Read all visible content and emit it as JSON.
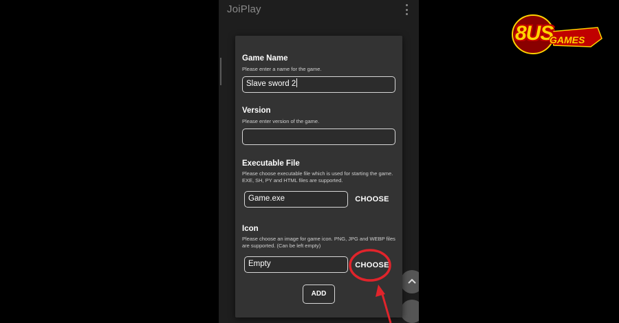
{
  "appbar": {
    "title": "JoiPlay"
  },
  "dialog": {
    "game_name": {
      "label": "Game Name",
      "hint": "Please enter a name for the game.",
      "value": "Slave sword 2"
    },
    "version": {
      "label": "Version",
      "hint": "Please enter version of the game.",
      "value": ""
    },
    "executable": {
      "label": "Executable File",
      "hint": "Please choose executable file which is used for starting the game. EXE, SH, PY and HTML files are supported.",
      "value": "Game.exe",
      "button": "CHOOSE"
    },
    "icon": {
      "label": "Icon",
      "hint": "Please choose an image for game icon. PNG, JPG and WEBP files are supported. (Can be left empty)",
      "value": "Empty",
      "button": "CHOOSE"
    },
    "add_button": "ADD"
  },
  "watermark": {
    "logo_main": "8US",
    "logo_sub": "GAMES"
  },
  "colors": {
    "annotation": "#e0242b",
    "logo_yellow": "#ffd400",
    "logo_red": "#c00000",
    "dialog_bg": "#333333"
  },
  "icons": [
    "kebab-menu-icon",
    "chevron-up-icon"
  ]
}
